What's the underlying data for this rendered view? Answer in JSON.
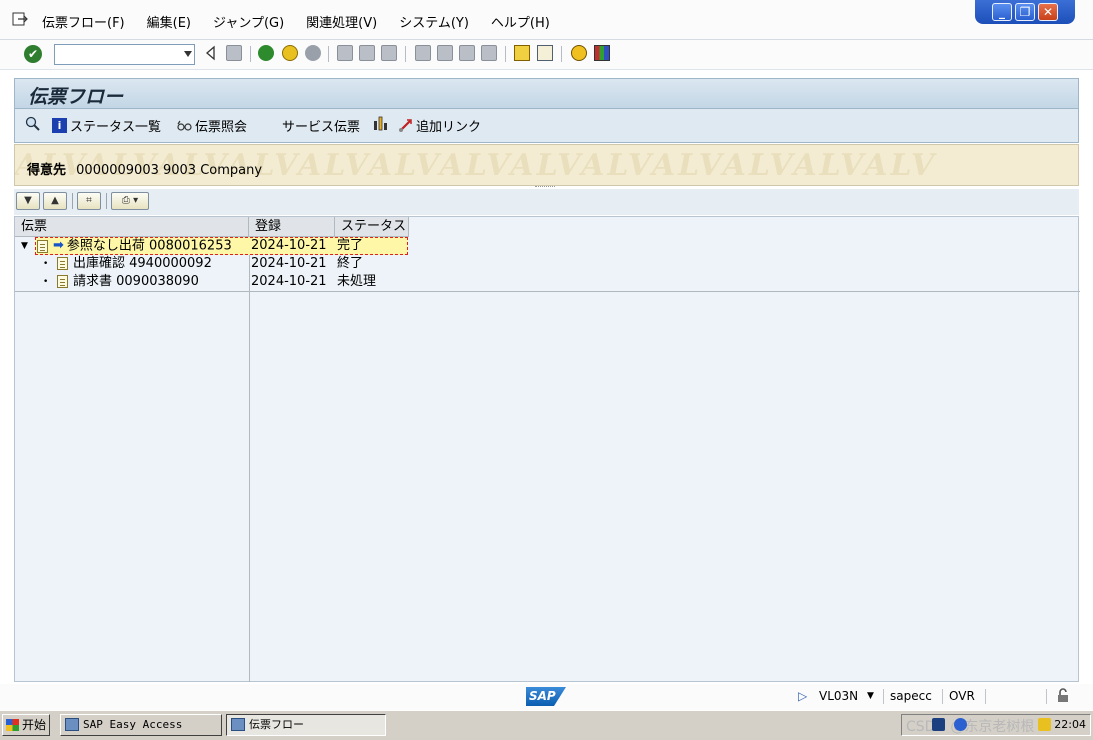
{
  "menubar": {
    "items": [
      "伝票フロー(F)",
      "編集(E)",
      "ジャンプ(G)",
      "関連処理(V)",
      "システム(Y)",
      "ヘルプ(H)"
    ]
  },
  "window_controls": {
    "minimize": "_",
    "restore": "❐",
    "close": "✕"
  },
  "command_field": {
    "value": ""
  },
  "title": "伝票フロー",
  "app_toolbar": {
    "status_overview": "ステータス一覧",
    "document_display": "伝票照会",
    "service_document": "サービス伝票",
    "additional_links": "追加リンク"
  },
  "header": {
    "label": "得意先",
    "value": "0000009003 9003 Company",
    "watermark": "ALVALVALVALVALVALVALVALVALVALVALVALVALV"
  },
  "tree": {
    "columns": [
      "伝票",
      "登録",
      "ステータス"
    ],
    "rows": [
      {
        "document": "参照なし出荷 0080016253",
        "date": "2024-10-21",
        "status": "完了",
        "level": 0,
        "expanded": true,
        "selected": true
      },
      {
        "document": "出庫確認 4940000092",
        "date": "2024-10-21",
        "status": "終了",
        "level": 1
      },
      {
        "document": "請求書 0090038090",
        "date": "2024-10-21",
        "status": "未処理",
        "level": 1
      }
    ]
  },
  "statusbar": {
    "logo": "SAP",
    "transaction": "VL03N",
    "server": "sapecc",
    "mode": "OVR"
  },
  "taskbar": {
    "start": "开始",
    "tasks": [
      "SAP Easy Access",
      "伝票フロー"
    ],
    "clock": "22:04",
    "watermark": "CSDN @东京老树根"
  }
}
